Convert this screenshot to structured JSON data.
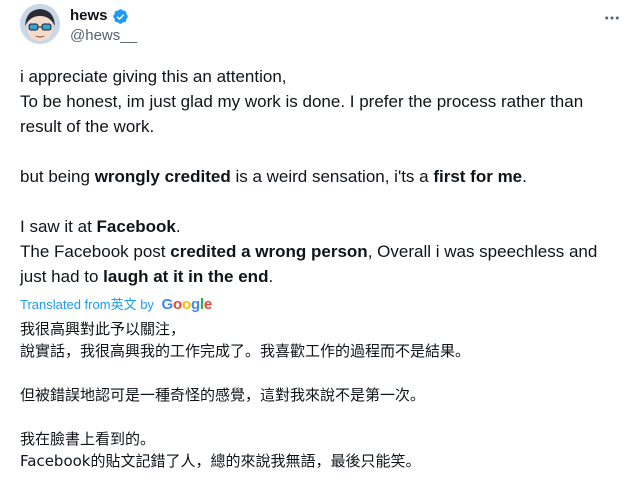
{
  "author": {
    "display_name": "hews",
    "handle": "@hews__",
    "verified_color": "#1d9bf0"
  },
  "menu": {
    "more_icon": "ellipsis-icon"
  },
  "post": {
    "line1": "i appreciate giving this an attention,",
    "line2": "To be honest, im just glad my work is done. I prefer the process rather than result of the work.",
    "line3_a": "but being ",
    "line3_b": "wrongly credited",
    "line3_c": " is a weird sensation, i'ts a ",
    "line3_d": "first for me",
    "line3_e": ".",
    "line4_a": "I saw it at ",
    "line4_b": "Facebook",
    "line4_c": ".",
    "line5_a": "The Facebook post ",
    "line5_b": "credited a wrong person",
    "line5_c": ", Overall i was speechless and just had to ",
    "line5_d": "laugh at it in the end",
    "line5_e": "."
  },
  "translation_notice": {
    "prefix": "Translated from ",
    "language": "英文",
    "by": " by ",
    "provider_parts": [
      "G",
      "o",
      "o",
      "g",
      "l",
      "e"
    ],
    "link_color": "#1d9bf0"
  },
  "translation": {
    "line1": "我很高興對此予以關注，",
    "line2": "說實話，我很高興我的工作完成了。我喜歡工作的過程而不是結果。",
    "line3": "但被錯誤地認可是一種奇怪的感覺，這對我來說不是第一次。",
    "line4": "我在臉書上看到的。",
    "line5": "Facebook的貼文記錯了人，總的來說我無語，最後只能笑。"
  }
}
